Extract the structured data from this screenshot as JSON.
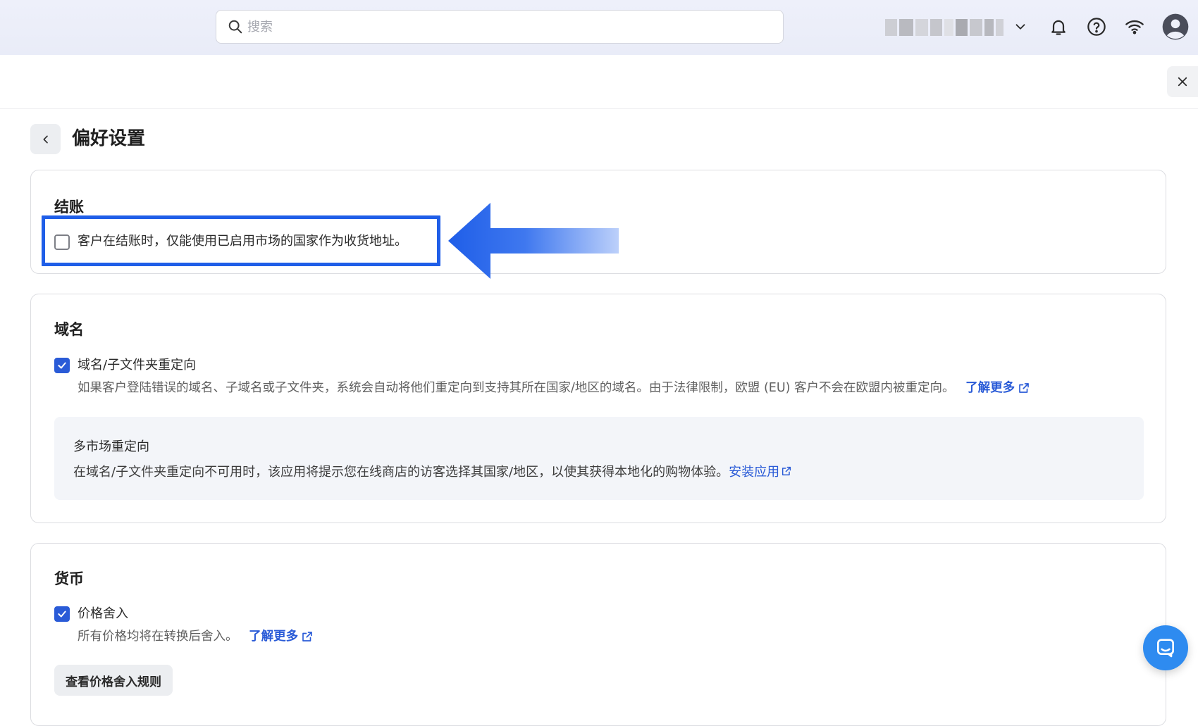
{
  "topbar": {
    "search_placeholder": "搜索",
    "store_name_blur_colors": [
      "#c9cad0",
      "#b8b9bf",
      "#d3d4da",
      "#a9aab0",
      "#c4c5cb",
      "#b0b1b7",
      "#cfd0d6",
      "#bdbec4",
      "#c7c8ce"
    ],
    "icons": [
      "chevron-down-icon",
      "bell-icon",
      "help-icon",
      "wifi-icon",
      "avatar-icon"
    ]
  },
  "page": {
    "title": "偏好设置"
  },
  "checkout": {
    "title": "结账",
    "option_label": "客户在结账时，仅能使用已启用市场的国家作为收货地址。",
    "option_checked": false
  },
  "domain": {
    "title": "域名",
    "option_label": "域名/子文件夹重定向",
    "option_checked": true,
    "option_desc": "如果客户登陆错误的域名、子域名或子文件夹，系统会自动将他们重定向到支持其所在国家/地区的域名。由于法律限制，欧盟 (EU) 客户不会在欧盟内被重定向。",
    "learn_more": "了解更多",
    "panel_title": "多市场重定向",
    "panel_desc": "在域名/子文件夹重定向不可用时，该应用将提示您在线商店的访客选择其国家/地区，以使其获得本地化的购物体验。",
    "install_app": "安装应用"
  },
  "currency": {
    "title": "货币",
    "option_label": "价格舍入",
    "option_checked": true,
    "option_desc": "所有价格均将在转换后舍入。",
    "learn_more": "了解更多",
    "rules_button": "查看价格舍入规则"
  },
  "colors": {
    "accent": "#2a5bd7",
    "highlight": "#1f5ee8",
    "chat": "#2e8bf0"
  }
}
